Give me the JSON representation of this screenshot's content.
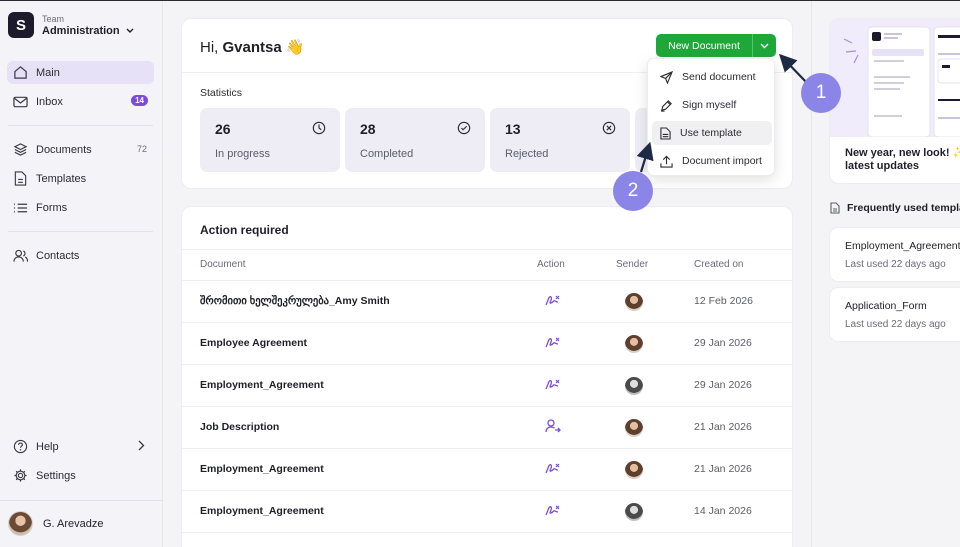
{
  "sidebar": {
    "team_small": "Team",
    "team_name": "Administration",
    "items": [
      {
        "label": "Main",
        "icon": "home-icon"
      },
      {
        "label": "Inbox",
        "badge": "14",
        "icon": "inbox-icon"
      },
      {
        "label": "Documents",
        "count": "72",
        "icon": "documents-icon"
      },
      {
        "label": "Templates",
        "icon": "templates-icon"
      },
      {
        "label": "Forms",
        "icon": "forms-icon"
      },
      {
        "label": "Contacts",
        "icon": "contacts-icon"
      },
      {
        "label": "Help",
        "icon": "help-icon"
      },
      {
        "label": "Settings",
        "icon": "settings-icon"
      }
    ],
    "user_name": "G. Arevadze"
  },
  "greeting": {
    "prefix": "Hi,",
    "name": "Gvantsa",
    "emoji": "👋"
  },
  "new_document_label": "New Document",
  "statistics": {
    "title": "Statistics",
    "cards": [
      {
        "value": "26",
        "label": "In progress",
        "icon": "clock-icon"
      },
      {
        "value": "28",
        "label": "Completed",
        "icon": "check-circle-icon"
      },
      {
        "value": "13",
        "label": "Rejected",
        "icon": "x-circle-icon"
      }
    ]
  },
  "dropdown_menu": [
    {
      "label": "Send document",
      "icon": "send-icon"
    },
    {
      "label": "Sign myself",
      "icon": "pen-icon"
    },
    {
      "label": "Use template",
      "icon": "template-file-icon"
    },
    {
      "label": "Document import",
      "icon": "upload-icon"
    }
  ],
  "action_required": {
    "title": "Action required",
    "columns": [
      "Document",
      "Action",
      "Sender",
      "Created on"
    ],
    "rows": [
      {
        "document": "შრომითი ხელშეკრულება_Amy Smith",
        "action": "sign-icon",
        "date": "12 Feb 2026"
      },
      {
        "document": "Employee Agreement",
        "action": "sign-icon",
        "date": "29 Jan 2026"
      },
      {
        "document": "Employment_Agreement",
        "action": "sign-icon",
        "date": "29 Jan 2026"
      },
      {
        "document": "Job Description",
        "action": "assign-user-icon",
        "date": "21 Jan 2026"
      },
      {
        "document": "Employment_Agreement",
        "action": "sign-icon",
        "date": "21 Jan 2026"
      },
      {
        "document": "Employment_Agreement",
        "action": "sign-icon",
        "date": "14 Jan 2026"
      }
    ]
  },
  "promo": {
    "text_line1": "New year, new look! ✨",
    "text_line2": "latest updates"
  },
  "frequent": {
    "title": "Frequently used templa",
    "items": [
      {
        "name": "Employment_Agreement",
        "used": "Last used 22 days ago"
      },
      {
        "name": "Application_Form",
        "used": "Last used 22 days ago"
      }
    ]
  },
  "annotations": [
    "1",
    "2"
  ],
  "colors": {
    "accent": "#7b4ae2",
    "primary_button": "#1fa83a",
    "annotation": "#8c85e8",
    "active_nav": "#e6e1f7"
  }
}
